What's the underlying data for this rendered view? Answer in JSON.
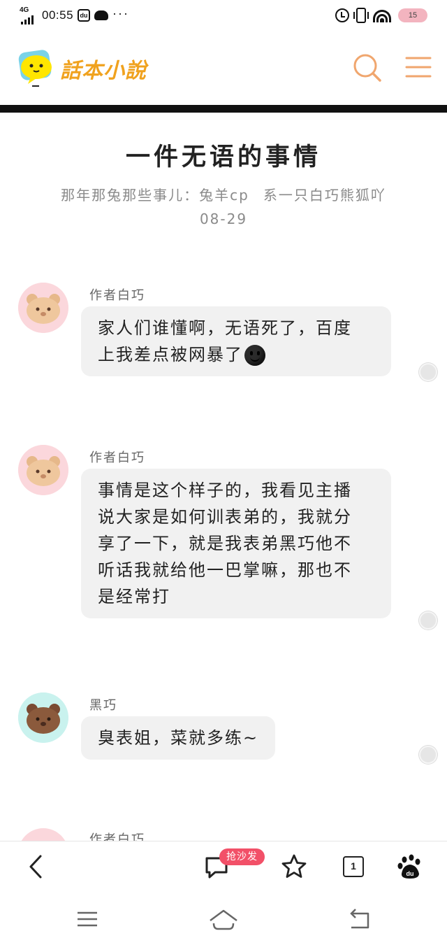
{
  "status_bar": {
    "network": "4G",
    "network_sup": "HD",
    "time": "00:55",
    "notif_icon_label": "du",
    "more": "···",
    "battery": "15"
  },
  "header": {
    "app_name": "話本小說",
    "logo_icon": "speech-bubble-mascot",
    "search_icon": "search-icon",
    "menu_icon": "menu-icon"
  },
  "article": {
    "title": "一件无语的事情",
    "book": "那年那兔那些事儿：兔羊cp",
    "author": "系一只白巧熊狐吖",
    "date": "08-29"
  },
  "messages": [
    {
      "name": "作者白巧",
      "lines": [
        "家人们谁懂啊，无语死了，百度",
        "上我差点被网暴了"
      ],
      "has_emoji": true
    },
    {
      "name": "作者白巧",
      "lines": [
        "事情是这个样子的，我看见主播",
        "说大家是如何训表弟的，我就分",
        "享了一下，就是我表弟黑巧他不",
        "听话我就给他一巴掌嘛，那也不",
        "是经常打"
      ],
      "has_emoji": false
    },
    {
      "name": "黑巧",
      "lines": [
        "臭表姐，菜就多练~"
      ],
      "has_emoji": false
    },
    {
      "name": "作者白巧",
      "lines": [],
      "has_emoji": false
    }
  ],
  "toolbar": {
    "back_icon": "back-arrow-icon",
    "comment_icon": "comment-icon",
    "sofa_badge": "抢沙发",
    "star_icon": "star-icon",
    "tab_count": "1",
    "baidu_icon": "baidu-paw-icon"
  },
  "system_nav": {
    "menu": "menu-icon",
    "home": "home-icon",
    "back": "return-icon"
  }
}
